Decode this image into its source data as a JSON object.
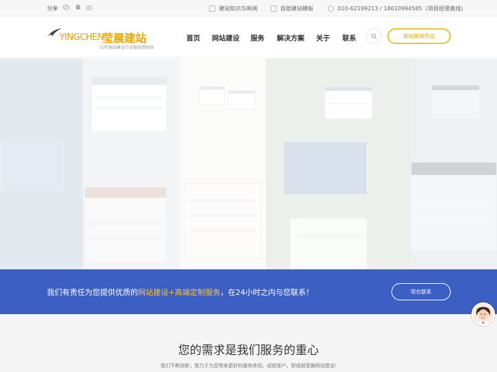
{
  "topbar": {
    "share_label": "分享",
    "icons": [
      "wechat-icon",
      "qq-icon",
      "weibo-icon"
    ],
    "links": [
      {
        "label": "建站知识与新闻",
        "icon": "document-icon"
      },
      {
        "label": "自助建站模板",
        "icon": "template-icon"
      },
      {
        "label": "010-62199213 / 18610994585（项目经理直线)",
        "icon": "clock-icon"
      }
    ]
  },
  "header": {
    "logo": {
      "latin": "YINGCHEN",
      "cn": "莹晨建站",
      "tagline": "10年网站建设行业服务提供商"
    },
    "nav": [
      "首页",
      "网站建设",
      "服务",
      "解决方案",
      "关于",
      "联系"
    ],
    "cta_label": "网站案例作品"
  },
  "band": {
    "message_prefix": "我们有责任为您提供优质的",
    "message_highlight": "网站建设+高端定制服务",
    "message_suffix": "，在24小时之内与您联系！",
    "button_label": "现在联系"
  },
  "section": {
    "title": "您的需求是我们服务的重心",
    "subtitle": "我们不断创新，致力于为您带来更好的服务体验，成就客户，即成就莹晨网站建设!"
  },
  "colors": {
    "accent": "#f2c12e",
    "band": "#3c5fc4",
    "highlight": "#f6c440"
  }
}
